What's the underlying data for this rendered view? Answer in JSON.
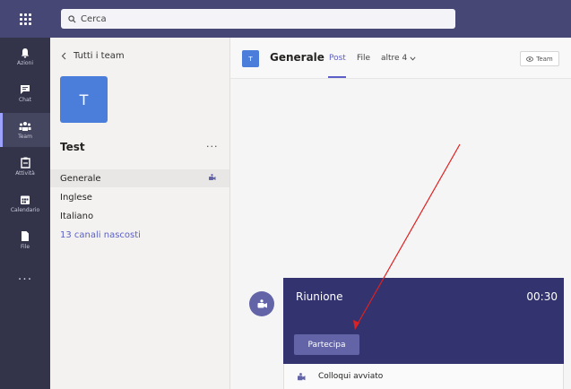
{
  "search": {
    "placeholder": "Cerca"
  },
  "rail": {
    "items": [
      {
        "label": "Azioni",
        "icon": "bell-icon"
      },
      {
        "label": "Chat",
        "icon": "chat-icon"
      },
      {
        "label": "Team",
        "icon": "teams-icon"
      },
      {
        "label": "Attività",
        "icon": "assignments-icon"
      },
      {
        "label": "Calendario",
        "icon": "calendar-icon"
      },
      {
        "label": "File",
        "icon": "file-icon"
      }
    ],
    "more": "..."
  },
  "sidebar": {
    "back_label": "Tutti i team",
    "team_initial": "T",
    "team_name": "Test",
    "team_more": "...",
    "channels": [
      {
        "label": "Generale"
      },
      {
        "label": "Inglese"
      },
      {
        "label": "Italiano"
      },
      {
        "label": "13 canali nascosti"
      }
    ]
  },
  "header": {
    "channel_initial": "T",
    "title": "Generale",
    "tabs": [
      {
        "label": "Post"
      },
      {
        "label": "File"
      },
      {
        "label": "altre 4"
      }
    ],
    "team_button": "Team"
  },
  "meeting": {
    "title": "Riunione",
    "time": "00:30",
    "join_label": "Partecipa",
    "started_label": "Colloqui avviato"
  },
  "colors": {
    "topbar": "#464775",
    "rail": "#33344a",
    "accent": "#5b5fc7",
    "meeting_card": "#33346f",
    "annotation_arrow": "#e02020"
  }
}
